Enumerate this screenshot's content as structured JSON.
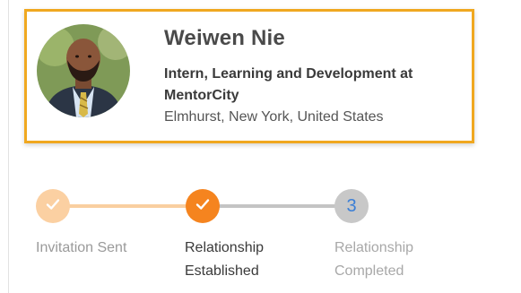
{
  "profile": {
    "name": "Weiwen Nie",
    "title": "Intern, Learning and Development at MentorCity",
    "location": "Elmhurst, New York, United States",
    "accent_color": "#f0a820"
  },
  "stepper": {
    "steps": [
      {
        "label": "Invitation Sent",
        "state": "complete",
        "icon": "check-icon",
        "color": "#fbd0a2"
      },
      {
        "label": "Relationship Established",
        "state": "current",
        "icon": "check-icon",
        "color": "#f5841f"
      },
      {
        "label": "Relationship Completed",
        "state": "pending",
        "number": "3",
        "color": "#c8c8c8"
      }
    ]
  }
}
